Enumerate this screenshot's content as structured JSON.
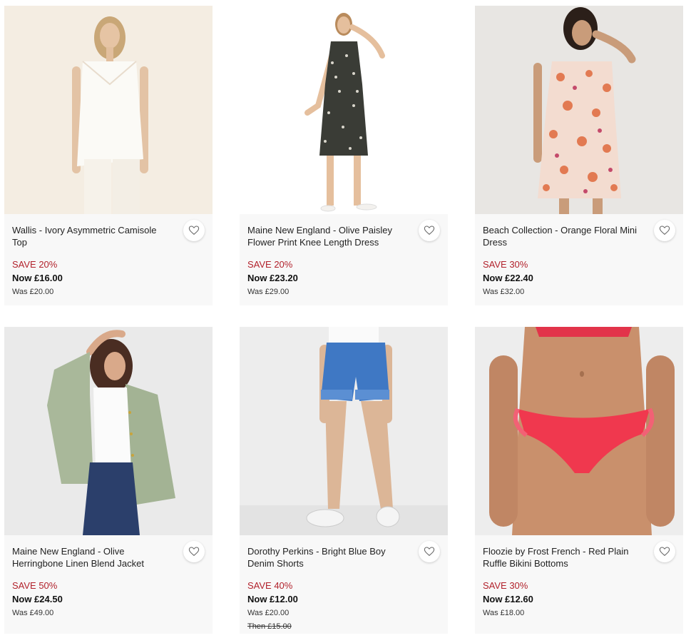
{
  "products": [
    {
      "name": "Wallis - Ivory Asymmetric Camisole Top",
      "save": "SAVE 20%",
      "now": "Now £16.00",
      "was": "Was £20.00",
      "then": "",
      "image": "model-ivory-camisole-top",
      "bg": "#f4eee4"
    },
    {
      "name": "Maine New England - Olive Paisley Flower Print Knee Length Dress",
      "save": "SAVE 20%",
      "now": "Now £23.20",
      "was": "Was £29.00",
      "then": "",
      "image": "model-paisley-dress",
      "bg": "#ffffff"
    },
    {
      "name": "Beach Collection - Orange Floral Mini Dress",
      "save": "SAVE 30%",
      "now": "Now £22.40",
      "was": "Was £32.00",
      "then": "",
      "image": "model-floral-mini-dress",
      "bg": "#e9e7e5"
    },
    {
      "name": "Maine New England - Olive Herringbone Linen Blend Jacket",
      "save": "SAVE 50%",
      "now": "Now £24.50",
      "was": "Was £49.00",
      "then": "",
      "image": "model-linen-jacket",
      "bg": "#ececec"
    },
    {
      "name": "Dorothy Perkins - Bright Blue Boy Denim Shorts",
      "save": "SAVE 40%",
      "now": "Now £12.00",
      "was": "Was £20.00",
      "then": "Then £15.00",
      "image": "model-denim-shorts",
      "bg": "#ededed"
    },
    {
      "name": "Floozie by Frost French - Red Plain Ruffle Bikini Bottoms",
      "save": "SAVE 30%",
      "now": "Now £12.60",
      "was": "Was £18.00",
      "then": "",
      "image": "model-red-bikini-bottoms",
      "bg": "#eeeeee"
    }
  ],
  "colors": {
    "sale_red": "#b2222c",
    "card_bg": "#f8f8f8"
  },
  "icons": {
    "wishlist": "heart-outline-icon"
  }
}
